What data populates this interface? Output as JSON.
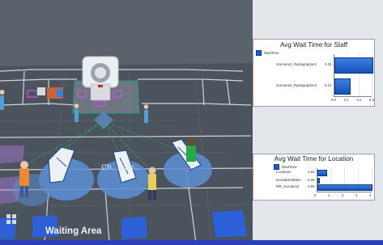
{
  "viewport": {
    "floor_labels": {
      "waiting_area": "Waiting Area",
      "change_cubicle": "Ch... cub..."
    }
  },
  "chart_data": [
    {
      "type": "bar",
      "orientation": "horizontal",
      "title": "Avg Wait Time for Staff",
      "legend": [
        "WaitTime"
      ],
      "categories": [
        "Scenario2_Radiographer1",
        "Scenario2_Radiographer2"
      ],
      "values": [
        0.32,
        0.12
      ],
      "value_labels": [
        "0.32",
        "0.12"
      ],
      "xlim": [
        0,
        0.3
      ],
      "xticks": [
        "0.0",
        "0.1",
        "0.2",
        "0.3"
      ],
      "grid": true,
      "legend_position": "top-left"
    },
    {
      "type": "bar",
      "orientation": "horizontal",
      "title": "Avg Wait Time for Location",
      "legend": [
        "WaitTime"
      ],
      "categories": [
        "Locations",
        "DockableTables",
        "MR_Scenario2"
      ],
      "values": [
        0.63,
        0.09,
        3.93
      ],
      "value_labels": [
        "0.63",
        "0.09",
        "3.93"
      ],
      "xlim": [
        0,
        4
      ],
      "xticks": [
        "0",
        "1",
        "2",
        "3",
        "4"
      ],
      "grid": true,
      "legend_position": "top-left"
    }
  ],
  "colors": {
    "bar": "#1f5fbf",
    "floor": "#58606a",
    "panel_bg": "#e3e6ea",
    "accent_blue": "#2b3fb8",
    "zone_purple": "#b07de0"
  }
}
